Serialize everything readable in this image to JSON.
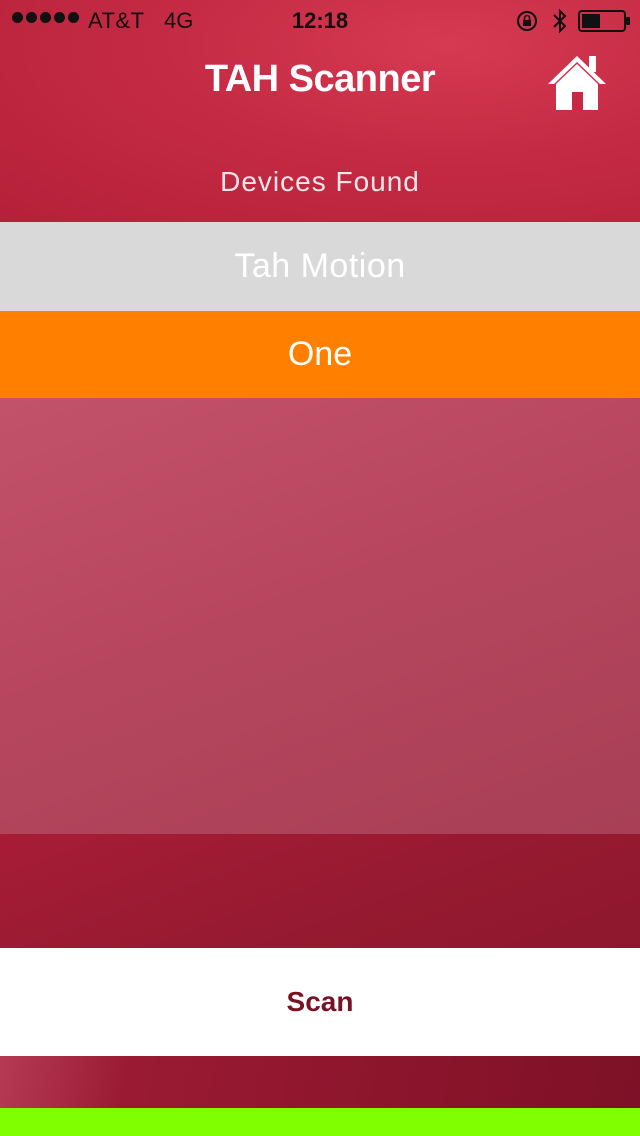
{
  "status_bar": {
    "carrier": "AT&T",
    "network": "4G",
    "time": "12:18",
    "signal_icon": "signal-dots-icon",
    "rotation_lock_icon": "rotation-lock-icon",
    "bluetooth_icon": "bluetooth-icon",
    "battery_icon": "battery-icon",
    "battery_level": 0.45
  },
  "nav": {
    "title": "TAH Scanner",
    "home_icon": "home-icon"
  },
  "section": {
    "label": "Devices Found"
  },
  "devices": [
    {
      "label": "Tah Motion"
    },
    {
      "label": "One"
    }
  ],
  "actions": {
    "scan_label": "Scan"
  },
  "colors": {
    "accent_primary": "#c52a44",
    "device_row_bg": "#d9d9d9",
    "selected_row_bg": "#ff8000",
    "scan_text": "#7a1226",
    "bottom_accent": "#7fff00"
  }
}
